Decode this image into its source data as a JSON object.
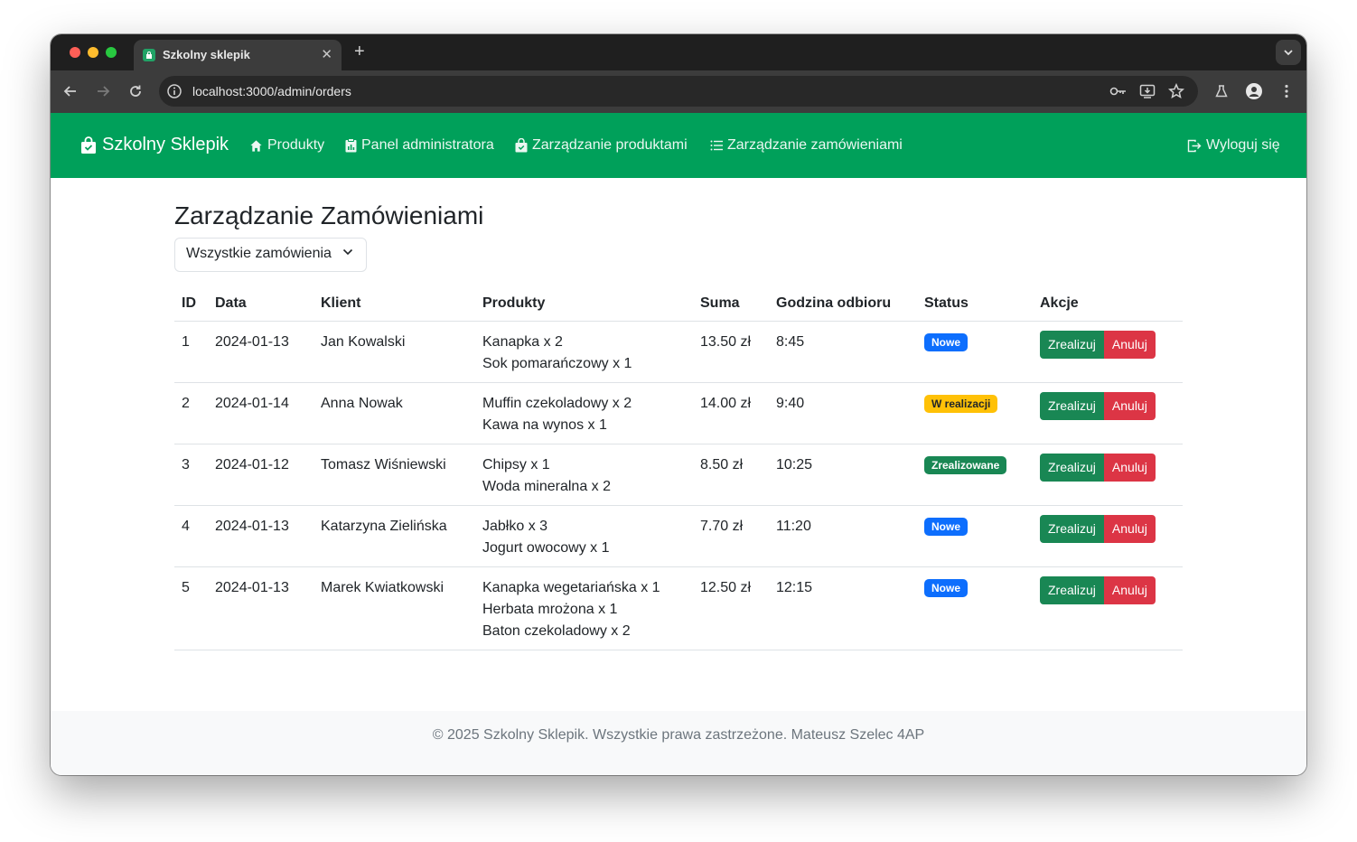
{
  "browser": {
    "tab_title": "Szkolny sklepik",
    "url": "localhost:3000/admin/orders"
  },
  "navbar": {
    "brand": "Szkolny Sklepik",
    "items": [
      {
        "label": "Produkty",
        "icon": "house-icon"
      },
      {
        "label": "Panel administratora",
        "icon": "clipboard-icon"
      },
      {
        "label": "Zarządzanie produktami",
        "icon": "shopping-bag-icon"
      },
      {
        "label": "Zarządzanie zamówieniami",
        "icon": "list-icon"
      }
    ],
    "logout": "Wyloguj się"
  },
  "page": {
    "title": "Zarządzanie Zamówieniami",
    "filter_selected": "Wszystkie zamówienia"
  },
  "table": {
    "headers": [
      "ID",
      "Data",
      "Klient",
      "Produkty",
      "Suma",
      "Godzina odbioru",
      "Status",
      "Akcje"
    ],
    "rows": [
      {
        "id": "1",
        "date": "2024-01-13",
        "client": "Jan Kowalski",
        "products": [
          "Kanapka x 2",
          "Sok pomarańczowy x 1"
        ],
        "sum": "13.50 zł",
        "pickup": "8:45",
        "status": "Nowe"
      },
      {
        "id": "2",
        "date": "2024-01-14",
        "client": "Anna Nowak",
        "products": [
          "Muffin czekoladowy x 2",
          "Kawa na wynos x 1"
        ],
        "sum": "14.00 zł",
        "pickup": "9:40",
        "status": "W realizacji"
      },
      {
        "id": "3",
        "date": "2024-01-12",
        "client": "Tomasz Wiśniewski",
        "products": [
          "Chipsy x 1",
          "Woda mineralna x 2"
        ],
        "sum": "8.50 zł",
        "pickup": "10:25",
        "status": "Zrealizowane"
      },
      {
        "id": "4",
        "date": "2024-01-13",
        "client": "Katarzyna Zielińska",
        "products": [
          "Jabłko x 3",
          "Jogurt owocowy x 1"
        ],
        "sum": "7.70 zł",
        "pickup": "11:20",
        "status": "Nowe"
      },
      {
        "id": "5",
        "date": "2024-01-13",
        "client": "Marek Kwiatkowski",
        "products": [
          "Kanapka wegetariańska x 1",
          "Herbata mrożona x 1",
          "Baton czekoladowy x 2"
        ],
        "sum": "12.50 zł",
        "pickup": "12:15",
        "status": "Nowe"
      }
    ],
    "actions": {
      "complete": "Zrealizuj",
      "cancel": "Anuluj"
    }
  },
  "status_colors": {
    "Nowe": {
      "bg": "#0d6efd",
      "fg": "#ffffff"
    },
    "W realizacji": {
      "bg": "#ffc107",
      "fg": "#212529"
    },
    "Zrealizowane": {
      "bg": "#198754",
      "fg": "#ffffff"
    }
  },
  "colors": {
    "navbar": "#00a05a",
    "success": "#198754",
    "danger": "#dc3545"
  },
  "footer": "© 2025 Szkolny Sklepik. Wszystkie prawa zastrzeżone. Mateusz Szelec 4AP"
}
